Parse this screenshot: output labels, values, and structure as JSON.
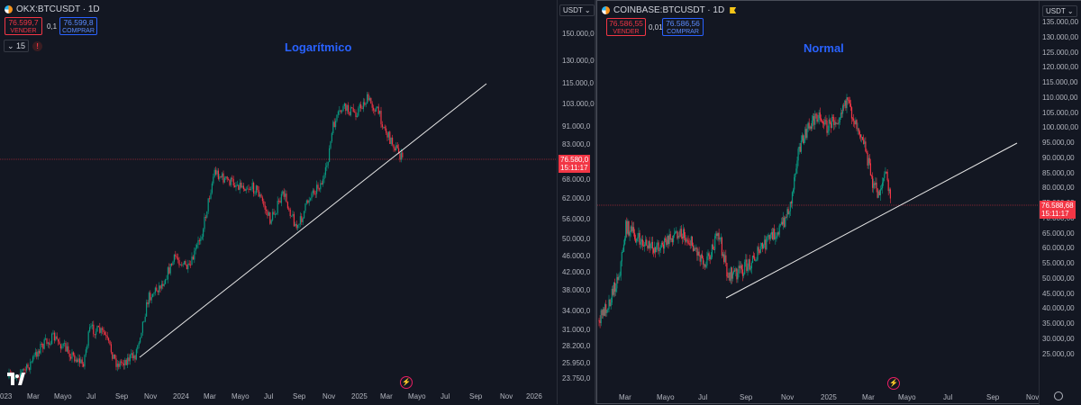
{
  "left": {
    "symbol": "OKX:BTCUSDT · 1D",
    "sell_price": "76.599,7",
    "sell_label": "VENDER",
    "spread": "0,1",
    "buy_price": "76.599,8",
    "buy_label": "COMPRAR",
    "indicator_count": "15",
    "warning_icon": "!",
    "title": "Logarítmico",
    "currency": "USDT",
    "current_price": "76.580,0",
    "countdown": "15:11:17",
    "price_axis": [
      "150.000,0",
      "130.000,0",
      "115.000,0",
      "103.000,0",
      "91.000,0",
      "83.000,0",
      "68.000,0",
      "62.000,0",
      "56.000,0",
      "50.000,0",
      "46.000,0",
      "42.000,0",
      "38.000,0",
      "34.000,0",
      "31.000,0",
      "28.200,0",
      "25.950,0",
      "23.750,0"
    ],
    "time_axis": [
      "023",
      "Mar",
      "Mayo",
      "Jul",
      "Sep",
      "Nov",
      "2024",
      "Mar",
      "Mayo",
      "Jul",
      "Sep",
      "Nov",
      "2025",
      "Mar",
      "Mayo",
      "Jul",
      "Sep",
      "Nov",
      "2026"
    ],
    "scale": "log"
  },
  "right": {
    "symbol": "COINBASE:BTCUSDT · 1D",
    "sell_price": "76.586,55",
    "sell_label": "VENDER",
    "spread": "0,01",
    "buy_price": "76.586,56",
    "buy_label": "COMPRAR",
    "title": "Normal",
    "currency": "USDT",
    "current_price": "76.588,68",
    "countdown": "15:11:17",
    "price_axis": [
      "135.000,00",
      "130.000,00",
      "125.000,00",
      "120.000,00",
      "115.000,00",
      "110.000,00",
      "105.000,00",
      "100.000,00",
      "95.000,00",
      "90.000,00",
      "85.000,00",
      "80.000,00",
      "75.000,00",
      "70.000,00",
      "65.000,00",
      "60.000,00",
      "55.000,00",
      "50.000,00",
      "45.000,00",
      "40.000,00",
      "35.000,00",
      "30.000,00",
      "25.000,00"
    ],
    "time_axis": [
      "Mar",
      "Mayo",
      "Jul",
      "Sep",
      "Nov",
      "2025",
      "Mar",
      "Mayo",
      "Jul",
      "Sep",
      "Nov"
    ],
    "scale": "linear"
  },
  "colors": {
    "up": "#089981",
    "down": "#f23645",
    "accent": "#2962ff",
    "trendline": "#e6e6e6"
  }
}
